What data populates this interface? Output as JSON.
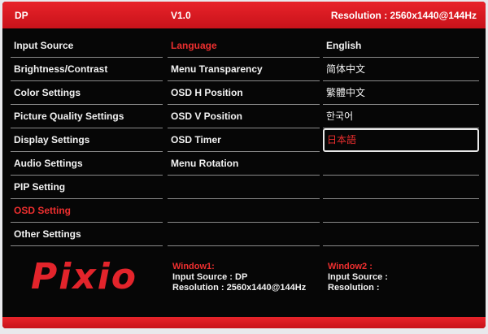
{
  "header": {
    "input": "DP",
    "version": "V1.0",
    "resolution": "Resolution : 2560x1440@144Hz"
  },
  "menu": [
    {
      "label": "Input Source"
    },
    {
      "label": "Brightness/Contrast"
    },
    {
      "label": "Color Settings"
    },
    {
      "label": "Picture Quality Settings"
    },
    {
      "label": "Display Settings"
    },
    {
      "label": "Audio Settings"
    },
    {
      "label": "PIP Setting"
    },
    {
      "label": "OSD Setting"
    },
    {
      "label": "Other Settings"
    }
  ],
  "submenu": [
    {
      "label": "Language"
    },
    {
      "label": "Menu Transparency"
    },
    {
      "label": "OSD H Position"
    },
    {
      "label": "OSD V Position"
    },
    {
      "label": "OSD Timer"
    },
    {
      "label": "Menu Rotation"
    }
  ],
  "languages": [
    {
      "label": "English"
    },
    {
      "label": "简体中文"
    },
    {
      "label": "繁體中文"
    },
    {
      "label": "한국어"
    },
    {
      "label": "日本語"
    }
  ],
  "logo": "Pixio",
  "window1": {
    "title": "Window1:",
    "input": "Input Source :  DP",
    "resolution": "Resolution :  2560x1440@144Hz"
  },
  "window2": {
    "title": "Window2 :",
    "input": "Input Source :",
    "resolution": "Resolution :"
  },
  "colors": {
    "accent": "#e3242b",
    "background": "#060606",
    "text": "#f2f2f2"
  }
}
